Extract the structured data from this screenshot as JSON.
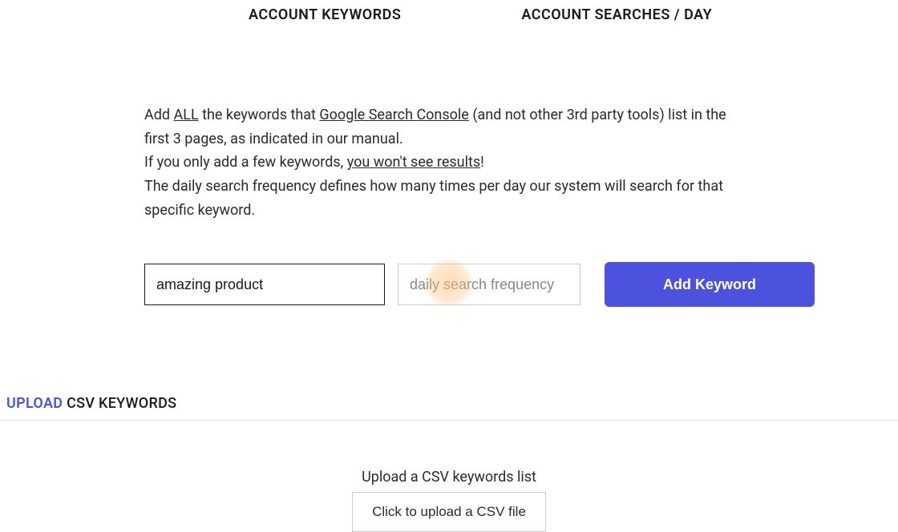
{
  "headers": {
    "keywords": "ACCOUNT KEYWORDS",
    "searches": "ACCOUNT SEARCHES / DAY"
  },
  "instructions": {
    "part1": "Add ",
    "all": "ALL",
    "part2": " the keywords that ",
    "gsc": "Google Search Console",
    "part3": " (and not other 3rd party tools) list in the first 3 pages, as indicated in our manual.",
    "part4": "If you only add a few keywords, ",
    "noresults": "you won't see results",
    "part5": "!",
    "part6": "The daily search frequency defines how many times per day our system will search for that specific keyword."
  },
  "form": {
    "keyword_value": "amazing product",
    "freq_placeholder": "daily search frequency",
    "add_label": "Add Keyword"
  },
  "upload_section": {
    "title_blue": "UPLOAD",
    "title_rest": " CSV KEYWORDS",
    "label": "Upload a CSV keywords list",
    "button": "Click to upload a CSV file"
  }
}
